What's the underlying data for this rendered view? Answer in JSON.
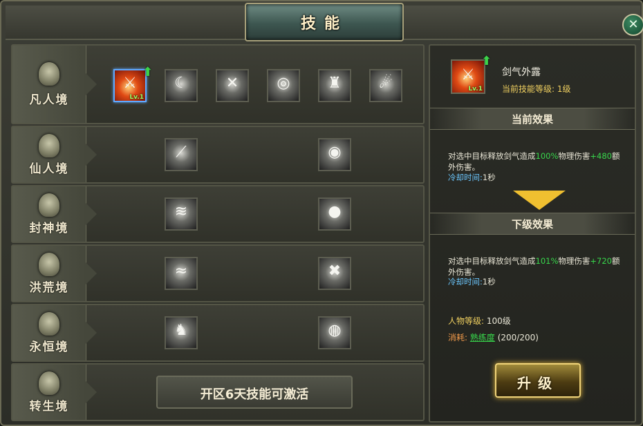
{
  "window": {
    "title": "技能",
    "close_glyph": "✕"
  },
  "tiers": [
    {
      "name": "凡人境"
    },
    {
      "name": "仙人境"
    },
    {
      "name": "封神境"
    },
    {
      "name": "洪荒境"
    },
    {
      "name": "永恒境"
    },
    {
      "name": "转生境"
    }
  ],
  "selected_skill": {
    "level_badge": "Lv.1"
  },
  "locked_tier_message": "开区6天技能可激活",
  "detail": {
    "skill_name": "剑气外露",
    "current_level_label": "当前技能等级:",
    "current_level_value": "1级",
    "current_effect_header": "当前效果",
    "current_effect": {
      "part1": "对选中目标释放剑气造成",
      "pct": "100%",
      "part2": "物理伤害",
      "bonus": "+480",
      "part3": "额外伤害。"
    },
    "cooldown_label": "冷却时间:",
    "cooldown_value": "1秒",
    "next_effect_header": "下级效果",
    "next_effect": {
      "part1": "对选中目标释放剑气造成",
      "pct": "101%",
      "part2": "物理伤害",
      "bonus": "+720",
      "part3": "额外伤害。"
    },
    "next_cooldown_label": "冷却时间:",
    "next_cooldown_value": "1秒",
    "req_level_label": "人物等级:",
    "req_level_value": "100级",
    "cost_label": "消耗:",
    "cost_item": "熟练度",
    "cost_value": "(200/200)",
    "upgrade_label": "升级"
  },
  "icons": [
    "sword-slash-icon",
    "crescent-blade-icon",
    "claw-slash-icon",
    "shield-strike-icon",
    "totem-icon",
    "comet-icon"
  ],
  "colors": {
    "accent_gold": "#f0c030",
    "effect_green": "#38d84c",
    "cooldown_blue": "#6cc8ff",
    "selected_border": "#5fa9ff"
  }
}
